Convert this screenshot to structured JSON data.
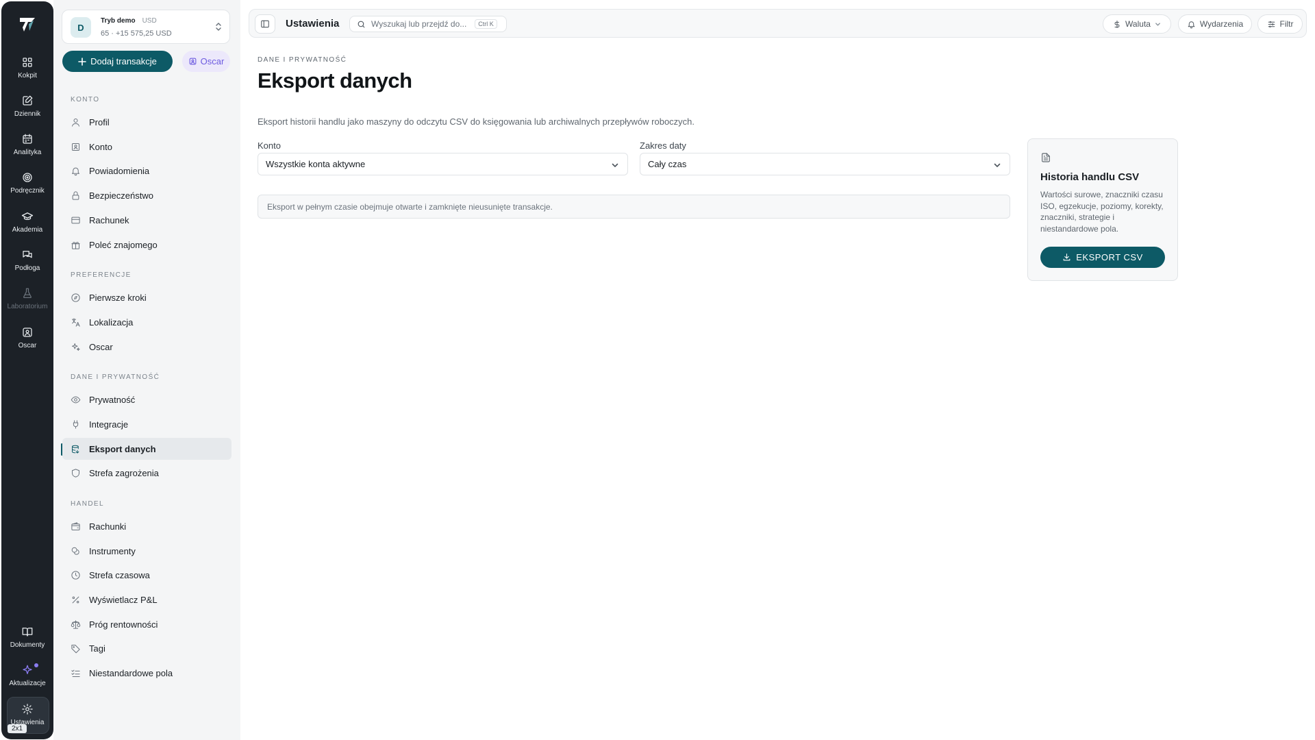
{
  "rail": {
    "items": [
      {
        "label": "Kokpit",
        "icon": "dashboard-icon"
      },
      {
        "label": "Dziennik",
        "icon": "journal-icon"
      },
      {
        "label": "Analityka",
        "icon": "calendar-icon"
      },
      {
        "label": "Podręcznik",
        "icon": "target-icon"
      },
      {
        "label": "Akademia",
        "icon": "graduation-cap-icon"
      },
      {
        "label": "Podłoga",
        "icon": "chat-icon"
      },
      {
        "label": "Laboratorium",
        "icon": "flask-icon"
      },
      {
        "label": "Oscar",
        "icon": "oscar-icon"
      },
      {
        "label": "Dokumenty",
        "icon": "book-icon"
      },
      {
        "label": "Aktualizacje",
        "icon": "sparkle-icon"
      },
      {
        "label": "Ustawienia",
        "icon": "gear-icon"
      }
    ],
    "badge": "2x1"
  },
  "account": {
    "avatar": "D",
    "mode": "Tryb demo",
    "currency": "USD",
    "summary": "65 · +15 575,25 USD"
  },
  "buttons": {
    "add_transactions": "Dodaj transakcje",
    "oscar": "Oscar"
  },
  "sidebar": {
    "sections": [
      {
        "heading": "KONTO",
        "items": [
          "Profil",
          "Konto",
          "Powiadomienia",
          "Bezpieczeństwo",
          "Rachunek",
          "Poleć znajomego"
        ]
      },
      {
        "heading": "PREFERENCJE",
        "items": [
          "Pierwsze kroki",
          "Lokalizacja",
          "Oscar"
        ]
      },
      {
        "heading": "DANE I PRYWATNOŚĆ",
        "items": [
          "Prywatność",
          "Integracje",
          "Eksport danych",
          "Strefa zagrożenia"
        ]
      },
      {
        "heading": "HANDEL",
        "items": [
          "Rachunki",
          "Instrumenty",
          "Strefa czasowa",
          "Wyświetlacz P&L",
          "Próg rentowności",
          "Tagi",
          "Niestandardowe pola"
        ]
      }
    ],
    "active": "Eksport danych"
  },
  "topbar": {
    "title": "Ustawienia",
    "search_placeholder": "Wyszukaj lub przejdź do...",
    "shortcut": "Ctrl K",
    "currency": "Waluta",
    "events": "Wydarzenia",
    "filter": "Filtr"
  },
  "main": {
    "breadcrumb": "DANE I PRYWATNOŚĆ",
    "title": "Eksport danych",
    "description": "Eksport historii handlu jako maszyny do odczytu CSV do księgowania lub archiwalnych przepływów roboczych.",
    "account_label": "Konto",
    "account_value": "Wszystkie konta aktywne",
    "range_label": "Zakres daty",
    "range_value": "Cały czas",
    "note": "Eksport w pełnym czasie obejmuje otwarte i zamknięte nieusunięte transakcje."
  },
  "card": {
    "title": "Historia handlu CSV",
    "text": "Wartości surowe, znaczniki czasu ISO, egzekucje, poziomy, korekty, znaczniki, strategie i niestandardowe pola.",
    "button": "EKSPORT CSV"
  },
  "colors": {
    "accent": "#0d5a66",
    "rail": "#1c2127",
    "purple": "#8a7cf0"
  }
}
